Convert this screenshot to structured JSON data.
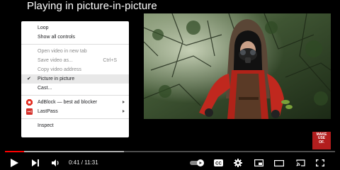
{
  "page": {
    "title": "Playing in picture-in-picture"
  },
  "context_menu": {
    "items": [
      {
        "label": "Loop",
        "disabled": false
      },
      {
        "label": "Show all controls",
        "disabled": false
      },
      {
        "label": "Open video in new tab",
        "disabled": true
      },
      {
        "label": "Save video as...",
        "shortcut": "Ctrl+S",
        "disabled": true
      },
      {
        "label": "Copy video address",
        "disabled": true
      },
      {
        "label": "Picture in picture",
        "checked": true,
        "disabled": false
      },
      {
        "label": "Cast...",
        "disabled": false
      },
      {
        "label": "AdBlock — best ad blocker",
        "icon": "adblock-icon",
        "submenu": true
      },
      {
        "label": "LastPass",
        "icon": "lastpass-icon",
        "submenu": true
      },
      {
        "label": "Inspect",
        "disabled": false
      }
    ],
    "check_glyph": "✔"
  },
  "logo": {
    "line1": "MAKE",
    "line2": "USE",
    "line3": "OF."
  },
  "player": {
    "current_time": "0:41",
    "duration": "11:31",
    "time_display": "0:41 / 11:31",
    "progress_played_fraction": 0.059,
    "progress_loaded_fraction": 0.36
  },
  "colors": {
    "progress": "#ff0000",
    "logo_bg": "#b21e1e",
    "adblock": "#e32a1d",
    "lastpass": "#d32d27"
  },
  "icons": [
    "play-icon",
    "next-icon",
    "volume-icon",
    "autoplay-toggle-icon",
    "subtitles-icon",
    "settings-icon",
    "miniplayer-icon",
    "theater-icon",
    "cast-icon",
    "fullscreen-icon"
  ]
}
